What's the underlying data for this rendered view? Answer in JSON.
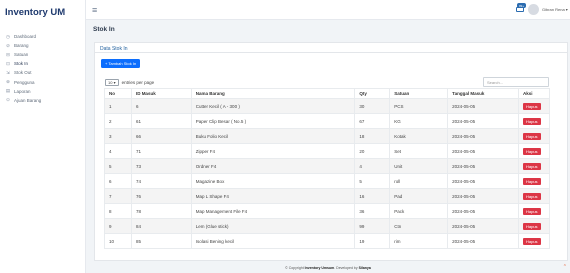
{
  "app": {
    "brand": "Inventory UM"
  },
  "sidebar": {
    "items": [
      {
        "label": "Dashboard",
        "icon": "◷"
      },
      {
        "label": "Barang",
        "icon": "⊘"
      },
      {
        "label": "Satuan",
        "icon": "⊟"
      },
      {
        "label": "Stok In",
        "icon": "⊡"
      },
      {
        "label": "Stok Out",
        "icon": "⇲"
      },
      {
        "label": "Pengguna",
        "icon": "⊗"
      },
      {
        "label": "Laporan",
        "icon": "▤"
      },
      {
        "label": "Ajuan Barang",
        "icon": "⊙"
      }
    ]
  },
  "topbar": {
    "badge": "99+",
    "user_name": "Gibran Rena"
  },
  "page": {
    "title": "Stok In"
  },
  "card": {
    "title": "Data Stok In",
    "add_label": "+ Tambah Stok In",
    "entries_value": "10",
    "entries_label": "entries per page",
    "search_placeholder": "Search..."
  },
  "table": {
    "headers": [
      "No",
      "ID Masuk",
      "Nama Barang",
      "Qty",
      "Satuan",
      "Tanggal Masuk",
      "Aksi"
    ],
    "delete_label": "Hapus",
    "rows": [
      [
        "1",
        "6",
        "Cutter Kecil ( A - 300 )",
        "30",
        "PCS",
        "2024-05-05"
      ],
      [
        "2",
        "61",
        "Paper Clip Besar ( No.5 )",
        "67",
        "KG",
        "2024-05-05"
      ],
      [
        "3",
        "66",
        "Buku Folio Kecil",
        "18",
        "Kotak",
        "2024-05-05"
      ],
      [
        "4",
        "71",
        "Zipper F4",
        "20",
        "Set",
        "2024-05-05"
      ],
      [
        "5",
        "73",
        "Ordner F4",
        "4",
        "Unit",
        "2024-05-05"
      ],
      [
        "6",
        "74",
        "Magazine Box",
        "5",
        "roll",
        "2024-05-05"
      ],
      [
        "7",
        "76",
        "Map L Shape F4",
        "16",
        "Pad",
        "2024-05-05"
      ],
      [
        "8",
        "78",
        "Map Management File F4",
        "36",
        "Pack",
        "2024-05-05"
      ],
      [
        "9",
        "84",
        "Lem (Glue stick)",
        "99",
        "Ctn",
        "2024-05-05"
      ],
      [
        "10",
        "85",
        "Isolasi Bening kecil",
        "19",
        "rim",
        "2024-05-05"
      ]
    ]
  },
  "footer": {
    "prefix": "© Copyright ",
    "strong": "Inventory Umsum",
    "mid": ". Developed by ",
    "dev": "Silanya"
  },
  "colors": {
    "primary": "#0d6efd",
    "danger": "#dc3545",
    "brand": "#1f3a6e"
  }
}
